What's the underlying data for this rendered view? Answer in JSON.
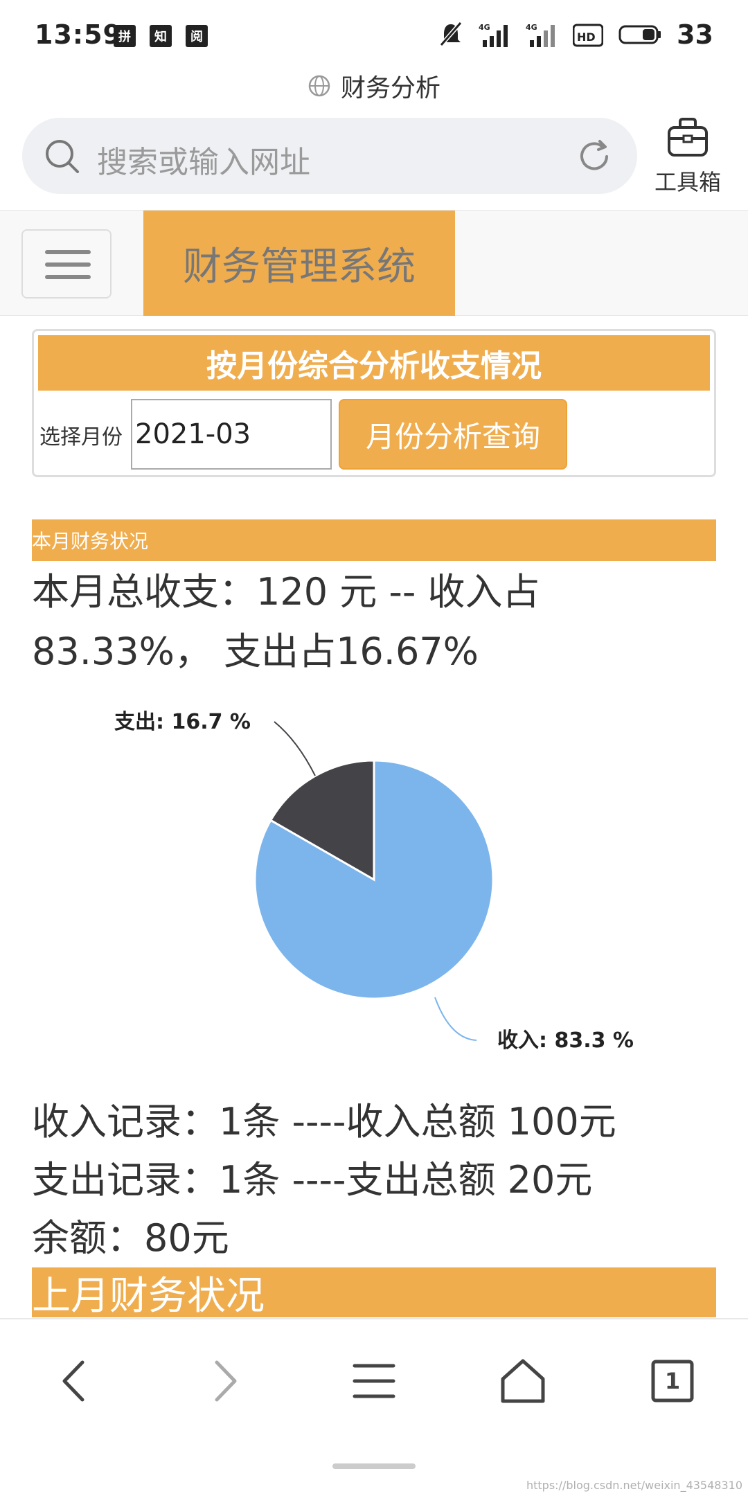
{
  "status_bar": {
    "time": "13:59",
    "app_icons": [
      "拼",
      "知",
      "阅"
    ],
    "battery_level": "33"
  },
  "browser": {
    "page_title": "财务分析",
    "address_placeholder": "搜索或输入网址",
    "toolbox_label": "工具箱",
    "tab_count": "1"
  },
  "navbar": {
    "brand": "财务管理系统"
  },
  "query_panel": {
    "heading": "按月份综合分析收支情况",
    "select_label": "选择月份",
    "month_value": "2021-03",
    "query_button": "月份分析查询"
  },
  "current_month": {
    "section_title": "本月财务状况",
    "summary_line1": "本月总收支：120 元 -- 收入占",
    "summary_line2": "83.33%， 支出占16.67%",
    "income_records": "收入记录：1条 ----收入总额 100元",
    "expense_records": "支出记录：1条 ----支出总额 20元",
    "balance": "余额：80元"
  },
  "last_month": {
    "section_title": "上月财务状况"
  },
  "chart_data": {
    "type": "pie",
    "series": [
      {
        "name": "收入",
        "value": 83.3,
        "label": "收入: 83.3 %",
        "color": "#7cb5ec"
      },
      {
        "name": "支出",
        "value": 16.7,
        "label": "支出: 16.7 %",
        "color": "#434348"
      }
    ]
  },
  "watermark": "https://blog.csdn.net/weixin_43548310",
  "colors": {
    "accent": "#f0ad4e",
    "income": "#7cb5ec",
    "expense": "#434348"
  }
}
